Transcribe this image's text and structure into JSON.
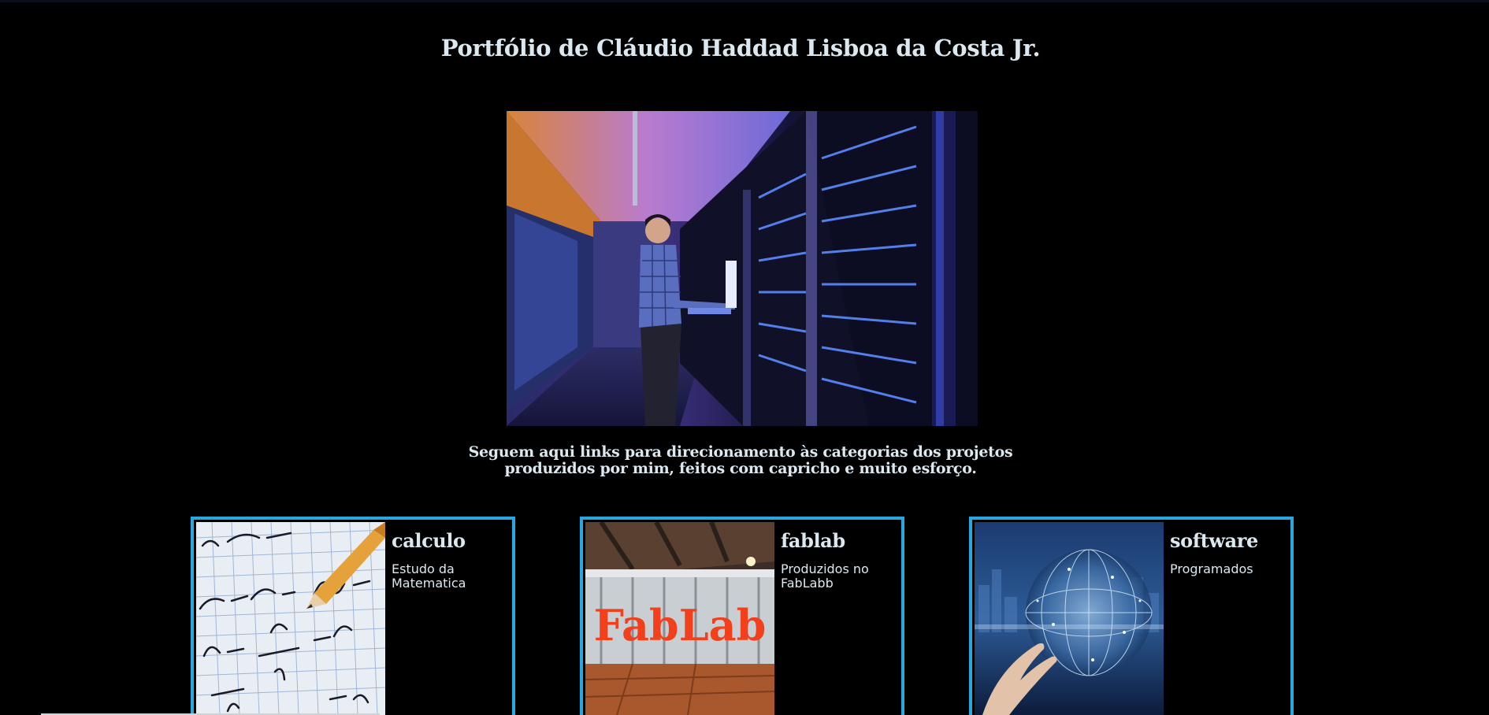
{
  "page": {
    "title": "Portfólio de Cláudio Haddad Lisboa da Costa Jr.",
    "intro": "Seguem aqui links para direcionamento às categorias dos projetos produzidos por mim, feitos com capricho e muito esforço."
  },
  "hero_image": {
    "alt": "server-room-photo"
  },
  "cards": [
    {
      "title": "calculo",
      "description": "Estudo da Matematica"
    },
    {
      "title": "fablab",
      "description": "Produzidos no FabLabb"
    },
    {
      "title": "software",
      "description": "Programados"
    }
  ],
  "colors": {
    "background": "#000000",
    "text": "#dce8ef",
    "card_border": "#29a8df"
  },
  "images": {
    "fablab_sign_text": "FabLab"
  }
}
